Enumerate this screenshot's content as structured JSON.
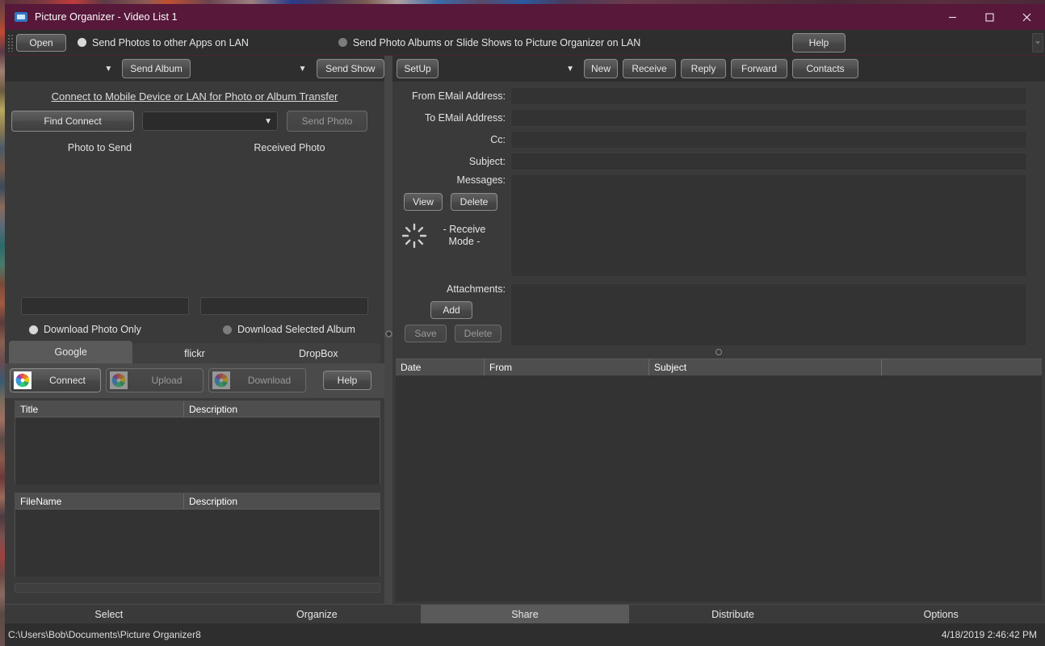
{
  "window": {
    "title": "Picture Organizer - Video List 1",
    "app_icon": "photo-folder-icon",
    "titlebar_color": "#57183a",
    "minimize": "–",
    "maximize": "□",
    "close": "✕"
  },
  "toolbar": {
    "open_label": "Open",
    "radio_send_photos": "Send Photos to other Apps on LAN",
    "radio_send_albums": "Send Photo Albums or Slide Shows to Picture Organizer on LAN",
    "help_label": "Help"
  },
  "left_panel": {
    "send_album_combo_value": "",
    "send_album_button": "Send Album",
    "send_show_combo_value": "",
    "send_show_button": "Send Show",
    "connect_link": "Connect to Mobile Device or LAN for Photo or Album Transfer",
    "find_connect_button": "Find Connect",
    "device_combo_value": "",
    "send_photo_button": "Send Photo",
    "photo_to_send_label": "Photo to Send",
    "received_photo_label": "Received Photo",
    "download_photo_only": "Download Photo Only",
    "download_selected_album": "Download Selected Album",
    "tabs": [
      {
        "label": "Google",
        "active": true
      },
      {
        "label": "flickr",
        "active": false
      },
      {
        "label": "DropBox",
        "active": false
      }
    ],
    "cloud_buttons": {
      "connect": "Connect",
      "upload": "Upload",
      "download": "Download",
      "help": "Help"
    },
    "album_list_headers": [
      "Title",
      "Description"
    ],
    "album_list_rows": [],
    "file_list_headers": [
      "FileName",
      "Description"
    ],
    "file_list_rows": []
  },
  "right_panel": {
    "setup_button": "SetUp",
    "account_combo_value": "",
    "buttons": {
      "new": "New",
      "receive": "Receive",
      "reply": "Reply",
      "forward": "Forward",
      "contacts": "Contacts"
    },
    "fields": [
      {
        "label": "From EMail Address:",
        "value": ""
      },
      {
        "label": "To EMail Address:",
        "value": ""
      },
      {
        "label": "Cc:",
        "value": ""
      },
      {
        "label": "Subject:",
        "value": ""
      }
    ],
    "messages_label": "Messages:",
    "messages_value": "",
    "view_button": "View",
    "delete_message_button": "Delete",
    "receive_mode_status": "- Receive Mode -",
    "attachments_label": "Attachments:",
    "attachments_value": "",
    "add_button": "Add",
    "save_button": "Save",
    "delete_attachment_button": "Delete",
    "mail_list_headers": [
      "Date",
      "From",
      "Subject",
      ""
    ],
    "mail_list_rows": []
  },
  "bottom_nav": [
    {
      "label": "Select",
      "active": false
    },
    {
      "label": "Organize",
      "active": false
    },
    {
      "label": "Share",
      "active": true
    },
    {
      "label": "Distribute",
      "active": false
    },
    {
      "label": "Options",
      "active": false
    }
  ],
  "status_bar": {
    "path": "C:\\Users\\Bob\\Documents\\Picture Organizer8",
    "datetime": "4/18/2019 2:46:42 PM"
  }
}
